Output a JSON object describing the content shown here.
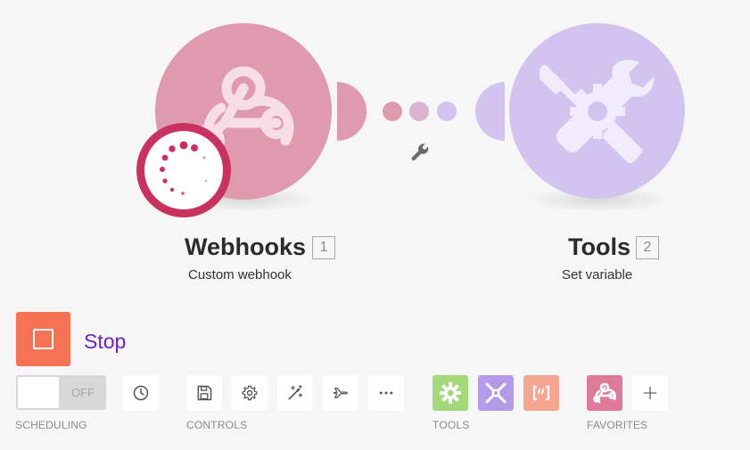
{
  "modules": [
    {
      "id": "webhooks",
      "title": "Webhooks",
      "number": "1",
      "subtitle": "Custom webhook",
      "color": "#e09ab0",
      "icon": "webhook-icon"
    },
    {
      "id": "tools",
      "title": "Tools",
      "number": "2",
      "subtitle": "Set variable",
      "color": "#d3c4ef",
      "icon": "tools-icon"
    }
  ],
  "connection": {
    "dot_colors": [
      "#e09ab0",
      "#dfa8c6",
      "#d3c4ef"
    ],
    "filter_icon": "wrench-icon"
  },
  "status": {
    "icon": "loading-spinner-icon",
    "color": "#c9325f"
  },
  "run": {
    "label": "Stop",
    "icon": "stop-icon",
    "color": "#f57354"
  },
  "scheduling": {
    "toggle_label": "OFF",
    "state": "off",
    "icon": "clock-icon",
    "label": "SCHEDULING"
  },
  "controls": {
    "label": "CONTROLS",
    "buttons": [
      "save-icon",
      "gear-icon",
      "magic-wand-icon",
      "airplane-icon",
      "more-icon"
    ]
  },
  "tools": {
    "label": "TOOLS",
    "buttons": [
      {
        "icon": "gear-icon",
        "color": "#a3d979"
      },
      {
        "icon": "tools-icon",
        "color": "#b69aea"
      },
      {
        "icon": "text-parser-icon",
        "color": "#f5a592"
      }
    ]
  },
  "favorites": {
    "label": "FAVORITES",
    "buttons": [
      {
        "icon": "webhook-icon",
        "color": "#e07a9b"
      },
      {
        "icon": "plus-icon"
      }
    ]
  }
}
